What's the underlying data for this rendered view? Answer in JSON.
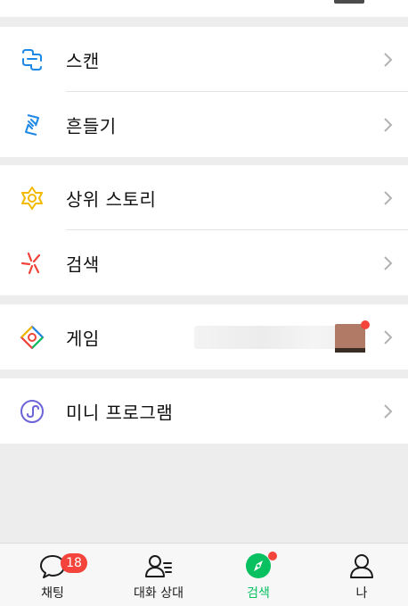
{
  "menu": {
    "group1": [
      {
        "label": "스캔",
        "icon": "scan-icon"
      },
      {
        "label": "흔들기",
        "icon": "shake-icon"
      }
    ],
    "group2": [
      {
        "label": "상위 스토리",
        "icon": "top-stories-icon"
      },
      {
        "label": "검색",
        "icon": "search-icon"
      }
    ],
    "group3": [
      {
        "label": "게임",
        "icon": "game-icon"
      }
    ],
    "group4": [
      {
        "label": "미니 프로그램",
        "icon": "mini-program-icon"
      }
    ]
  },
  "tabbar": {
    "tabs": [
      {
        "label": "채팅",
        "icon": "chat-icon",
        "badge": "18"
      },
      {
        "label": "대화 상대",
        "icon": "contacts-icon"
      },
      {
        "label": "검색",
        "icon": "discover-icon",
        "active": true
      },
      {
        "label": "나",
        "icon": "me-icon"
      }
    ]
  },
  "colors": {
    "accent": "#07c160",
    "badge": "#f5443b",
    "background": "#ededed"
  }
}
